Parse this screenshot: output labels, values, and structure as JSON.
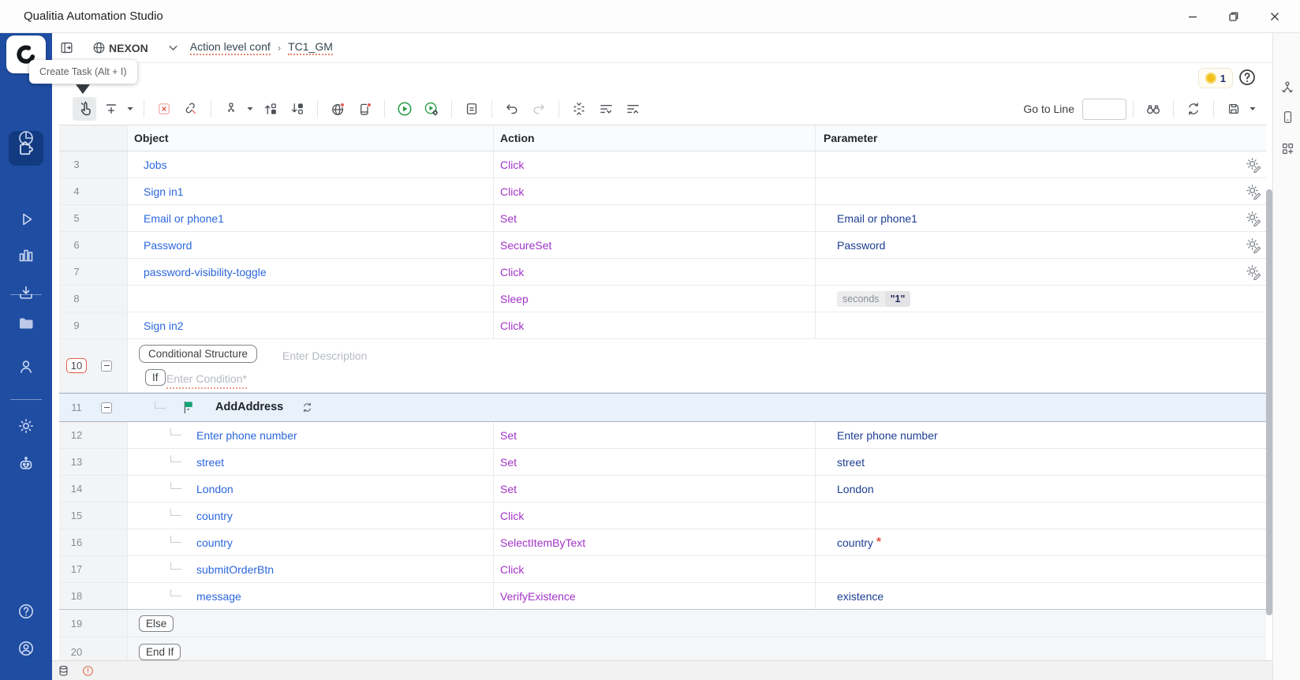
{
  "window": {
    "title": "Qualitia Automation Studio"
  },
  "tooltip": {
    "text": "Create Task (Alt + I)"
  },
  "topnav": {
    "project": "NEXON",
    "breadcrumb": [
      {
        "label": "Action level conf"
      },
      {
        "label": "TC1_GM"
      }
    ],
    "icons": [
      "panel-open-icon",
      "globe-icon",
      "chevron-down-icon"
    ]
  },
  "header_right": {
    "notification_count": "1",
    "icons": [
      "credits-badge-icon",
      "help-icon"
    ]
  },
  "toolbar": {
    "goto_line_label": "Go to Line",
    "goto_line_value": "",
    "icons": [
      "create-task-pointer-icon",
      "add-step-icon",
      "delete-step-icon",
      "unlink-icon",
      "conditional-structure-icon",
      "move-up-icon",
      "move-down-icon",
      "web-recorder-icon",
      "mobile-recorder-icon",
      "run-icon",
      "run-settings-icon",
      "notes-icon",
      "undo-icon",
      "redo-icon",
      "collapse-block-icon",
      "expand-all-icon",
      "collapse-all-icon",
      "find-icon",
      "sync-icon",
      "save-icon"
    ]
  },
  "sidebar": {
    "items": [
      "qualitia-logo",
      "dashboard-pie-icon",
      "tasks-puzzle-icon",
      "run-play-icon",
      "reports-bar-chart-icon",
      "import-download-icon",
      "projects-folder-icon",
      "users-person-icon",
      "settings-gear-icon",
      "bot-icon",
      "help-icon",
      "account-icon"
    ],
    "active_item": "tasks-puzzle-icon"
  },
  "rightrail": {
    "items": [
      "object-repository-3d-icon",
      "device-phone-icon",
      "add-widget-grid-icon"
    ]
  },
  "statusbar": {
    "items": [
      "database-icon",
      "alert-icon"
    ]
  },
  "table": {
    "columns": [
      "Object",
      "Action",
      "Parameter"
    ],
    "rows": [
      {
        "num": "3",
        "type": "step",
        "object": "Jobs",
        "action": "Click",
        "parameter": "",
        "gear": true
      },
      {
        "num": "4",
        "type": "step",
        "object": "Sign in1",
        "action": "Click",
        "parameter": "",
        "gear": true
      },
      {
        "num": "5",
        "type": "step",
        "object": "Email or phone1",
        "action": "Set",
        "parameter": "Email or phone1",
        "gear": true
      },
      {
        "num": "6",
        "type": "step",
        "object": "Password",
        "action": "SecureSet",
        "parameter": "Password",
        "gear": true
      },
      {
        "num": "7",
        "type": "step",
        "object": "password-visibility-toggle",
        "action": "Click",
        "parameter": "",
        "gear": true
      },
      {
        "num": "8",
        "type": "step",
        "object": "",
        "action": "Sleep",
        "param_chips": {
          "label": "seconds",
          "value": "\"1\""
        }
      },
      {
        "num": "9",
        "type": "step",
        "object": "Sign in2",
        "action": "Click",
        "parameter": ""
      },
      {
        "num": "10",
        "type": "conditional",
        "badge": "Conditional Structure",
        "description_placeholder": "Enter Description",
        "keyword": "If",
        "condition_placeholder": "Enter Condition*"
      },
      {
        "num": "11",
        "type": "task",
        "name": "AddAddress"
      },
      {
        "num": "12",
        "type": "step",
        "indent": true,
        "object": "Enter phone number",
        "action": "Set",
        "parameter": "Enter phone number"
      },
      {
        "num": "13",
        "type": "step",
        "indent": true,
        "object": "street",
        "action": "Set",
        "parameter": "street"
      },
      {
        "num": "14",
        "type": "step",
        "indent": true,
        "object": "London",
        "action": "Set",
        "parameter": "London"
      },
      {
        "num": "15",
        "type": "step",
        "indent": true,
        "object": "country",
        "action": "Click",
        "parameter": ""
      },
      {
        "num": "16",
        "type": "step",
        "indent": true,
        "object": "country",
        "action": "SelectItemByText",
        "parameter": "country",
        "required": true
      },
      {
        "num": "17",
        "type": "step",
        "indent": true,
        "object": "submitOrderBtn",
        "action": "Click",
        "parameter": ""
      },
      {
        "num": "18",
        "type": "step",
        "indent": true,
        "object": "message",
        "action": "VerifyExistence",
        "parameter": "existence",
        "block_end": true
      },
      {
        "num": "19",
        "type": "block",
        "badge": "Else"
      },
      {
        "num": "20",
        "type": "block",
        "badge": "End If"
      }
    ]
  },
  "colors": {
    "sidebar_blue": "#1f4da2",
    "sidebar_active": "#123a80",
    "link_blue": "#2b66dd",
    "action_purple": "#a233c7",
    "param_navy": "#1d3e93",
    "flag_green": "#16a374",
    "highlight_row": "#e9f1fb",
    "alert_orange": "#e2574c",
    "badge_yellow": "#f2c11e",
    "row_number_outline": "#e25c49"
  }
}
